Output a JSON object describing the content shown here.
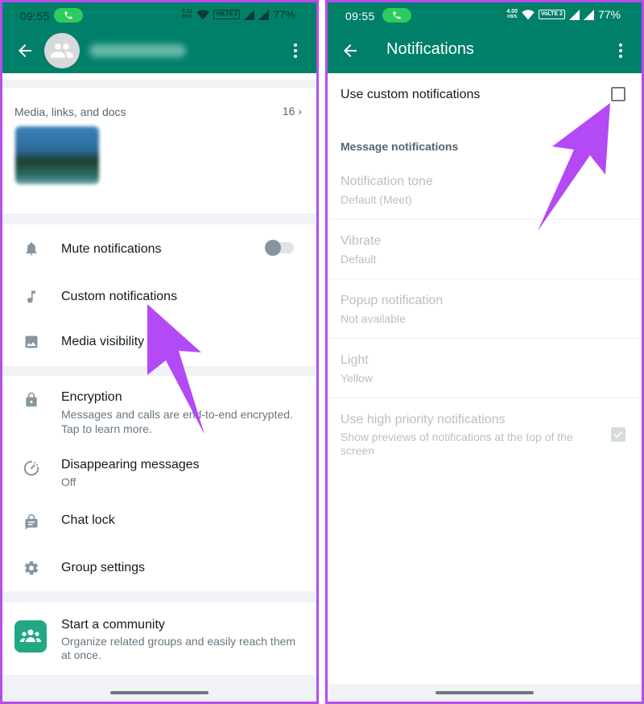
{
  "accent_colors": {
    "header_green": "#008069",
    "call_pill_green": "#2ecc5f",
    "community_green": "#1fa883",
    "annotation_purple": "#b34af5"
  },
  "left": {
    "status_bar": {
      "time": "09:55",
      "network_speed": "0.11",
      "network_speed_unit": "KB/S",
      "volte_label": "VoLTE 2",
      "battery": "77%"
    },
    "app_bar": {
      "back_icon": "arrow-left-icon",
      "avatar_icon": "group-icon",
      "group_name": "Travel Website",
      "group_name_blurred": true,
      "menu_icon": "more-vert-icon"
    },
    "media": {
      "title": "Media, links, and docs",
      "count": "16",
      "chevron": "›"
    },
    "settings_group_1": [
      {
        "icon": "bell-icon",
        "label": "Mute notifications",
        "toggle_on": false
      },
      {
        "icon": "music-note-icon",
        "label": "Custom notifications"
      },
      {
        "icon": "image-icon",
        "label": "Media visibility"
      }
    ],
    "settings_group_2": [
      {
        "icon": "lock-icon",
        "label": "Encryption",
        "subtitle": "Messages and calls are end-to-end encrypted. Tap to learn more."
      },
      {
        "icon": "timer-icon",
        "label": "Disappearing messages",
        "subtitle": "Off"
      },
      {
        "icon": "chat-lock-icon",
        "label": "Chat lock"
      },
      {
        "icon": "gear-icon",
        "label": "Group settings"
      }
    ],
    "community": {
      "icon": "community-icon",
      "label": "Start a community",
      "subtitle": "Organize related groups and easily reach them at once."
    }
  },
  "right": {
    "status_bar": {
      "time": "09:55",
      "network_speed": "4.00",
      "network_speed_unit": "KB/S",
      "volte_label": "VoLTE 2",
      "battery": "77%"
    },
    "app_bar": {
      "back_icon": "arrow-left-icon",
      "title": "Notifications",
      "menu_icon": "more-vert-icon"
    },
    "use_custom": {
      "label": "Use custom notifications",
      "checked": false
    },
    "section_heading": "Message notifications",
    "prefs": [
      {
        "title": "Notification tone",
        "value": "Default (Meet)"
      },
      {
        "title": "Vibrate",
        "value": "Default"
      },
      {
        "title": "Popup notification",
        "value": "Not available"
      },
      {
        "title": "Light",
        "value": "Yellow"
      }
    ],
    "high_priority": {
      "title": "Use high priority notifications",
      "subtitle": "Show previews of notifications at the top of the screen",
      "checked": true,
      "enabled": false
    }
  }
}
